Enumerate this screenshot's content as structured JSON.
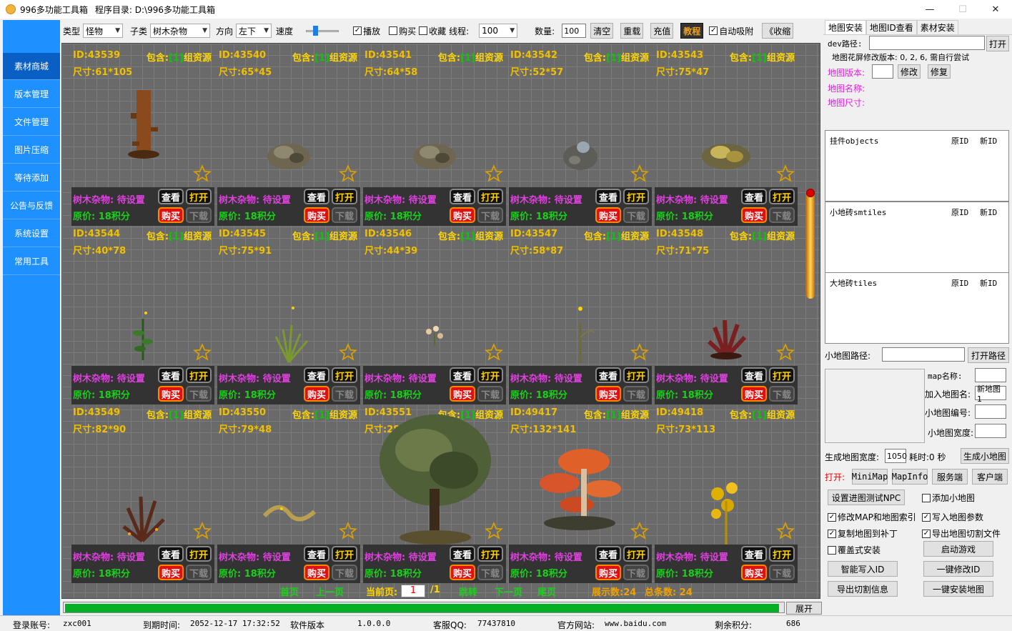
{
  "window": {
    "title": "996多功能工具箱",
    "dir_label": "程序目录: D:\\996多功能工具箱",
    "min": "—",
    "max": "☐",
    "close": "✕"
  },
  "sidebar": {
    "items": [
      {
        "label": "素材商城"
      },
      {
        "label": "版本管理"
      },
      {
        "label": "文件管理"
      },
      {
        "label": "图片压缩"
      },
      {
        "label": "等待添加"
      },
      {
        "label": "公告与反馈"
      },
      {
        "label": "系统设置"
      },
      {
        "label": "常用工具"
      }
    ]
  },
  "toolbar": {
    "type_label": "类型",
    "type_value": "怪物",
    "sub_label": "子类",
    "sub_value": "树木杂物",
    "dir_label": "方向",
    "dir_value": "左下",
    "speed_label": "速度",
    "play_label": "播放",
    "buy_label": "购买",
    "fav_label": "收藏",
    "thread_label": "线程:",
    "thread_value": "100",
    "count_label": "数量:",
    "count_value": "100",
    "clear": "清空",
    "reload": "重载",
    "recharge": "充值",
    "tutorial": "教程",
    "auto_label": "自动吸附",
    "collapse": "《收缩"
  },
  "cards": [
    {
      "id": "ID:43539",
      "pkg_pre": "包含:",
      "pkg_num": "[1]",
      "pkg_post": "组资源",
      "size": "尺寸:61*105",
      "status": "树木杂物: 待设置",
      "price": "原价: 18积分",
      "view": "查看",
      "open": "打开",
      "buy": "购买",
      "dl": "下载"
    },
    {
      "id": "ID:43540",
      "pkg_pre": "包含:",
      "pkg_num": "[1]",
      "pkg_post": "组资源",
      "size": "尺寸:65*45",
      "status": "树木杂物: 待设置",
      "price": "原价: 18积分",
      "view": "查看",
      "open": "打开",
      "buy": "购买",
      "dl": "下载"
    },
    {
      "id": "ID:43541",
      "pkg_pre": "包含:",
      "pkg_num": "[1]",
      "pkg_post": "组资源",
      "size": "尺寸:64*58",
      "status": "树木杂物: 待设置",
      "price": "原价: 18积分",
      "view": "查看",
      "open": "打开",
      "buy": "购买",
      "dl": "下载"
    },
    {
      "id": "ID:43542",
      "pkg_pre": "包含:",
      "pkg_num": "[1]",
      "pkg_post": "组资源",
      "size": "尺寸:52*57",
      "status": "树木杂物: 待设置",
      "price": "原价: 18积分",
      "view": "查看",
      "open": "打开",
      "buy": "购买",
      "dl": "下载"
    },
    {
      "id": "ID:43543",
      "pkg_pre": "包含:",
      "pkg_num": "[1]",
      "pkg_post": "组资源",
      "size": "尺寸:75*47",
      "status": "树木杂物: 待设置",
      "price": "原价: 18积分",
      "view": "查看",
      "open": "打开",
      "buy": "购买",
      "dl": "下载"
    },
    {
      "id": "ID:43544",
      "pkg_pre": "包含:",
      "pkg_num": "[1]",
      "pkg_post": "组资源",
      "size": "尺寸:40*78",
      "status": "树木杂物: 待设置",
      "price": "原价: 18积分",
      "view": "查看",
      "open": "打开",
      "buy": "购买",
      "dl": "下载"
    },
    {
      "id": "ID:43545",
      "pkg_pre": "包含:",
      "pkg_num": "[1]",
      "pkg_post": "组资源",
      "size": "尺寸:75*91",
      "status": "树木杂物: 待设置",
      "price": "原价: 18积分",
      "view": "查看",
      "open": "打开",
      "buy": "购买",
      "dl": "下载"
    },
    {
      "id": "ID:43546",
      "pkg_pre": "包含:",
      "pkg_num": "[1]",
      "pkg_post": "组资源",
      "size": "尺寸:44*39",
      "status": "树木杂物: 待设置",
      "price": "原价: 18积分",
      "view": "查看",
      "open": "打开",
      "buy": "购买",
      "dl": "下载"
    },
    {
      "id": "ID:43547",
      "pkg_pre": "包含:",
      "pkg_num": "[1]",
      "pkg_post": "组资源",
      "size": "尺寸:58*87",
      "status": "树木杂物: 待设置",
      "price": "原价: 18积分",
      "view": "查看",
      "open": "打开",
      "buy": "购买",
      "dl": "下载"
    },
    {
      "id": "ID:43548",
      "pkg_pre": "包含:",
      "pkg_num": "[1]",
      "pkg_post": "组资源",
      "size": "尺寸:71*75",
      "status": "树木杂物: 待设置",
      "price": "原价: 18积分",
      "view": "查看",
      "open": "打开",
      "buy": "购买",
      "dl": "下载"
    },
    {
      "id": "ID:43549",
      "pkg_pre": "包含:",
      "pkg_num": "[1]",
      "pkg_post": "组资源",
      "size": "尺寸:82*90",
      "status": "树木杂物: 待设置",
      "price": "原价: 18积分",
      "view": "查看",
      "open": "打开",
      "buy": "购买",
      "dl": "下载"
    },
    {
      "id": "ID:43550",
      "pkg_pre": "包含:",
      "pkg_num": "[1]",
      "pkg_post": "组资源",
      "size": "尺寸:79*48",
      "status": "树木杂物: 待设置",
      "price": "原价: 18积分",
      "view": "查看",
      "open": "打开",
      "buy": "购买",
      "dl": "下载"
    },
    {
      "id": "ID:43551",
      "pkg_pre": "包含:",
      "pkg_num": "[1]",
      "pkg_post": "组资源",
      "size": "尺寸:285*326",
      "status": "树木杂物: 待设置",
      "price": "原价: 18积分",
      "view": "查看",
      "open": "打开",
      "buy": "购买",
      "dl": "下载"
    },
    {
      "id": "ID:49417",
      "pkg_pre": "包含:",
      "pkg_num": "[1]",
      "pkg_post": "组资源",
      "size": "尺寸:132*141",
      "status": "树木杂物: 待设置",
      "price": "原价: 18积分",
      "view": "查看",
      "open": "打开",
      "buy": "购买",
      "dl": "下载"
    },
    {
      "id": "ID:49418",
      "pkg_pre": "包含:",
      "pkg_num": "[1]",
      "pkg_post": "组资源",
      "size": "尺寸:73*113",
      "status": "树木杂物: 待设置",
      "price": "原价: 18积分",
      "view": "查看",
      "open": "打开",
      "buy": "购买",
      "dl": "下载"
    }
  ],
  "pager": {
    "first": "首页",
    "prev": "上一页",
    "current_label": "当前页:",
    "current": "1",
    "total": "/1",
    "jump": "跳转",
    "next": "下一页",
    "last": "尾页",
    "shown": "展示数:24",
    "count": "总条数: 24"
  },
  "progress": {
    "fill_fraction": 0.995
  },
  "expand": "展开",
  "status": {
    "account_label": "登录账号:",
    "account": "zxc001",
    "expire_label": "到期时间:",
    "expire": "2052-12-17 17:32:52",
    "ver_label": "软件版本",
    "ver": "1.0.0.0",
    "qq_label": "客服QQ:",
    "qq": "77437810",
    "site_label": "官方网站:",
    "site": "www.baidu.com",
    "points_label": "剩余积分:",
    "points": "686"
  },
  "right": {
    "tabs": [
      "地图安装",
      "地图ID查看",
      "素材安装"
    ],
    "dev_label": "dev路径:",
    "open": "打开",
    "hint": "地图花屏修改版本: 0, 2, 6, 需自行尝试",
    "mapver_label": "地图版本:",
    "modify": "修改",
    "restore": "修复",
    "mapname_label": "地图名称:",
    "mapsize_label": "地图尺寸:",
    "lists": [
      {
        "title": "挂件objects",
        "c1": "原ID",
        "c2": "新ID"
      },
      {
        "title": "小地砖smtiles",
        "c1": "原ID",
        "c2": "新ID"
      },
      {
        "title": "大地砖tiles",
        "c1": "原ID",
        "c2": "新ID"
      }
    ],
    "mini_label": "小地图路径:",
    "open_path": "打开路径",
    "map_name_label": "map名称:",
    "join_name_label": "加入地图名:",
    "join_name_value": "新地图1",
    "mini_no_label": "小地图编号:",
    "mini_w_label": "小地图宽度:",
    "gen_w_label": "生成地图宽度:",
    "gen_w_value": "1050",
    "elapsed": "耗时:0 秒",
    "gen_btn": "生成小地图",
    "open_label": "打开:",
    "minimap": "MiniMap",
    "mapinfo": "MapInfo",
    "server": "服务端",
    "client": "客户端",
    "set_npc": "设置进图测试NPC",
    "add_mini": "添加小地图",
    "modify_map": "修改MAP和地图索引",
    "write_param": "写入地图参数",
    "copy_patch": "复制地图到补丁",
    "export_cut": "导出地图切割文件",
    "cover": "覆盖式安装",
    "start_game": "启动游戏",
    "smart_id": "智能写入ID",
    "one_modify": "一键修改ID",
    "export_info": "导出切割信息",
    "one_install": "一键安装地图"
  }
}
